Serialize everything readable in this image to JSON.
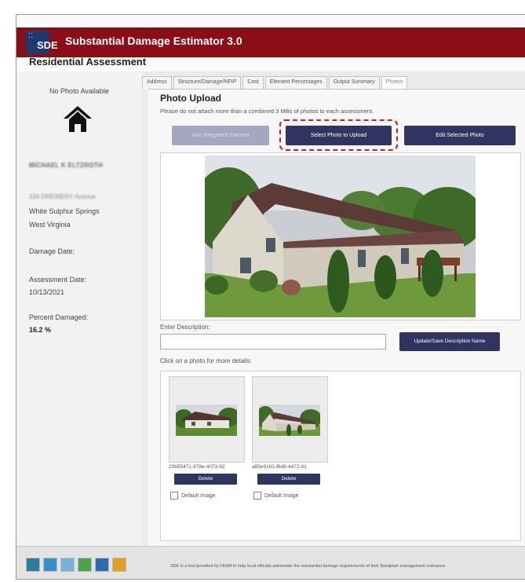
{
  "app": {
    "logo_text": "SDE",
    "title": "Substantial Damage Estimator 3.0",
    "page_heading": "Residential Assessment"
  },
  "sidebar": {
    "no_photo": "No Photo Available",
    "home_icon": "home-icon",
    "owner_name": "MICHAEL K ELTZROTH",
    "street": "334 DREWERY Avenue",
    "city": "White Sulphur Springs",
    "state": "West Virginia",
    "damage_date_label": "Damage Date:",
    "assessment_date_label": "Assessment Date:",
    "assessment_date": "10/13/2021",
    "percent_damaged_label": "Percent Damaged:",
    "percent_damaged": "16.2 %"
  },
  "tabs": [
    {
      "label": "Address"
    },
    {
      "label": "Structure/Damage/NFIP"
    },
    {
      "label": "Cost"
    },
    {
      "label": "Element Percentages"
    },
    {
      "label": "Output Summary"
    },
    {
      "label": "Photos"
    }
  ],
  "active_tab": "Photos",
  "photo_upload": {
    "title": "Photo Upload",
    "notice": "Please do not attach more than a combined 3 MBs of photos to each assessment.",
    "btn_camera": "Use Integrated Camera",
    "btn_upload": "Select Photo to Upload",
    "btn_edit": "Edit Selected Photo",
    "description_label": "Enter Description:",
    "description_value": "",
    "btn_save_description": "Update/Save Description Name",
    "click_label": "Click on a photo for more details:"
  },
  "photos": [
    {
      "name": "20b55471-978e-4073-92",
      "delete_label": "Delete",
      "default_label": "Default Image",
      "default_checked": false
    },
    {
      "name": "a85e9161-f6d9-4472-81",
      "delete_label": "Delete",
      "default_label": "Default Image",
      "default_checked": false
    }
  ],
  "footer": {
    "text": "SDE is a tool provided by FEMA to help local officials administer the substantial damage requirements of their floodplain management ordinance",
    "icons": [
      "fema-tool-icon-1",
      "fema-tool-icon-2",
      "fema-tool-icon-3",
      "fema-tool-icon-4",
      "fema-tool-icon-5",
      "fema-tool-icon-6"
    ],
    "icon_colors": [
      "#2a7d9c",
      "#3a8fc8",
      "#4aa34a",
      "#2c6db0",
      "#1c5fa0",
      "#e0a020"
    ]
  },
  "colors": {
    "title_bar": "#8b0e16",
    "button_primary": "#2f3560",
    "button_disabled": "#a3a8c0",
    "highlight": "#cc2222"
  }
}
